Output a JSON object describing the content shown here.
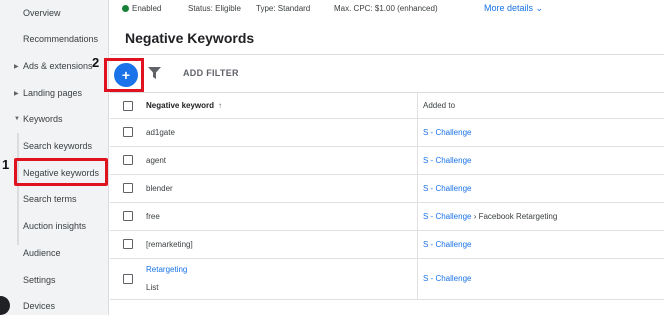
{
  "sidebar": {
    "items": [
      {
        "label": "Overview"
      },
      {
        "label": "Recommendations"
      },
      {
        "label": "Ads & extensions"
      },
      {
        "label": "Landing pages"
      },
      {
        "label": "Keywords"
      },
      {
        "label": "Search keywords"
      },
      {
        "label": "Negative keywords"
      },
      {
        "label": "Search terms"
      },
      {
        "label": "Auction insights"
      },
      {
        "label": "Audience"
      },
      {
        "label": "Settings"
      },
      {
        "label": "Devices"
      }
    ]
  },
  "annotations": {
    "step1": "1",
    "step2": "2"
  },
  "statusbar": {
    "enabled": "Enabled",
    "status": "Status: Eligible",
    "type": "Type: Standard",
    "max_cpc": "Max. CPC: $1.00 (enhanced)",
    "more_details": "More details"
  },
  "page": {
    "title": "Negative Keywords"
  },
  "toolbar": {
    "add_icon": "plus-icon",
    "add_filter": "ADD FILTER"
  },
  "table": {
    "headers": {
      "keyword": "Negative keyword",
      "added_to": "Added to"
    },
    "rows": [
      {
        "keyword": "ad1gate",
        "added_to": "S - Challenge"
      },
      {
        "keyword": "agent",
        "added_to": "S - Challenge"
      },
      {
        "keyword": "blender",
        "added_to": "S - Challenge"
      },
      {
        "keyword": "free",
        "added_to": "S - Challenge",
        "added_to_extra": "Facebook Retargeting"
      },
      {
        "keyword": "[remarketing]",
        "added_to": "S - Challenge"
      },
      {
        "keyword": "Retargeting",
        "keyword_sub": "List",
        "added_to": "S - Challenge"
      }
    ]
  },
  "colors": {
    "accent": "#1a73e8",
    "highlight": "#e0121f",
    "enabled_dot": "#188038"
  }
}
